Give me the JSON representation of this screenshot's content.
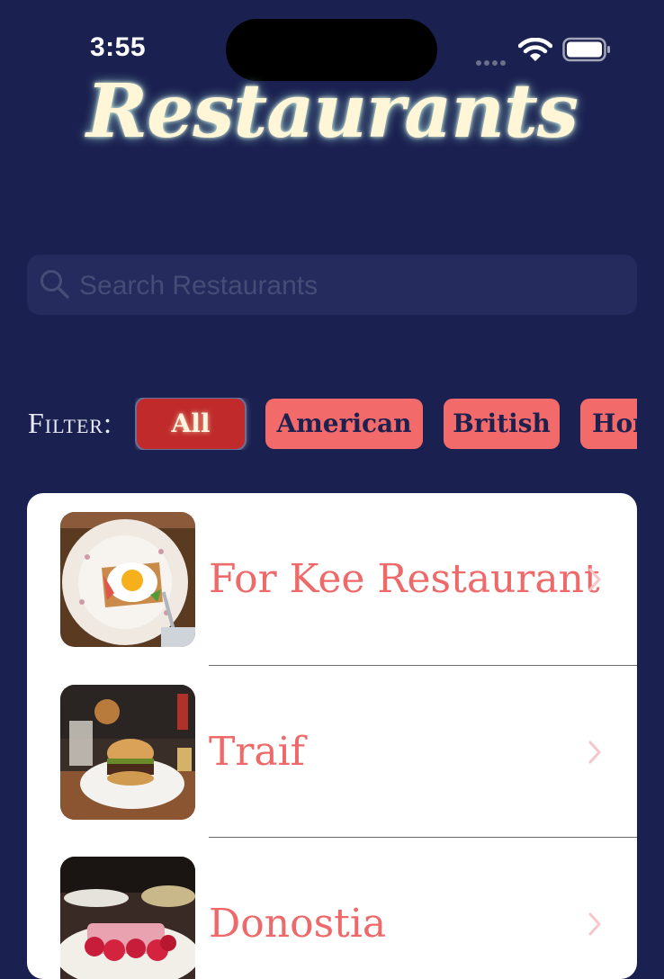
{
  "status_bar": {
    "time": "3:55"
  },
  "header": {
    "title": "Restaurants"
  },
  "search": {
    "placeholder": "Search Restaurants",
    "value": ""
  },
  "filter": {
    "label": "Filter:",
    "chips": [
      {
        "label": "All",
        "selected": true
      },
      {
        "label": "American",
        "selected": false
      },
      {
        "label": "British",
        "selected": false
      },
      {
        "label": "Hong Kong",
        "selected": false
      }
    ]
  },
  "restaurants": [
    {
      "name": "For Kee Restaurant",
      "image": "egg-toast-plate-photo"
    },
    {
      "name": "Traif",
      "image": "burger-plate-photo"
    },
    {
      "name": "Donostia",
      "image": "raspberry-dessert-photo"
    }
  ],
  "colors": {
    "background": "#1a2050",
    "chip": "#f26a6a",
    "chip_active": "#c02a2a",
    "row_text": "#ee6a6a"
  }
}
